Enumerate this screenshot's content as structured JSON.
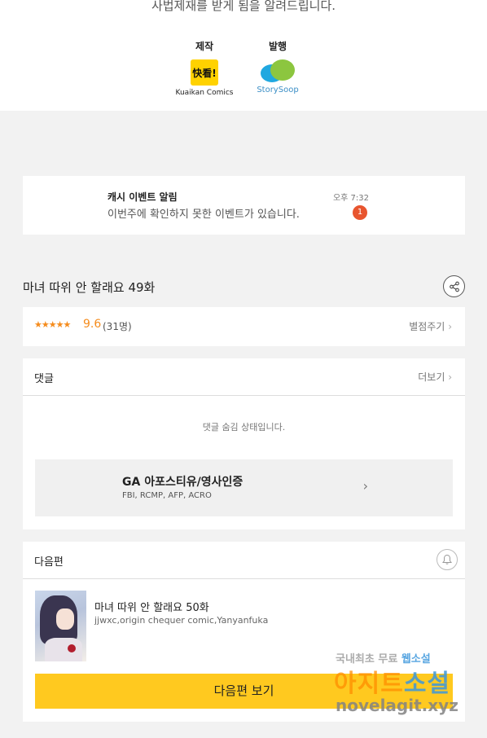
{
  "top": {
    "notice_text": "사법제재를 받게 됨을 알려드립니다.",
    "production_label": "제작",
    "production_logo_text": "快看!",
    "production_name": "Kuaikan Comics",
    "publisher_label": "발행",
    "publisher_name": "StorySoop"
  },
  "alert": {
    "title": "캐시 이벤트 알림",
    "message": "이번주에 확인하지 못한 이벤트가 있습니다.",
    "time": "오후 7:32",
    "badge": "1"
  },
  "episode": {
    "title": "마녀 따위 안 할래요 49화"
  },
  "rating": {
    "stars": "★★★★★",
    "score": "9.6",
    "count": "(31명)",
    "rate_link": "별점주기"
  },
  "comments": {
    "label": "댓글",
    "more_link": "더보기",
    "hidden_message": "댓글 숨김 상태입니다."
  },
  "ad": {
    "title": "GA 아포스티유/영사인증",
    "subtitle": "FBI, RCMP, AFP, ACRO"
  },
  "next": {
    "label": "다음편",
    "episode_title": "마녀 따위 안 할래요 50화",
    "authors": "jjwxc,origin chequer comic,Yanyanfuka",
    "button_label": "다음편 보기"
  },
  "watermark": {
    "line1_a": "국내최초 무료 ",
    "line1_b": "웹소설",
    "line2_a": "아지트",
    "line2_b": "소설",
    "line3": "novelagit.xyz"
  },
  "colors": {
    "accent_yellow": "#ffc91f",
    "star_orange": "#f58c1d",
    "badge_red": "#e8552f"
  }
}
